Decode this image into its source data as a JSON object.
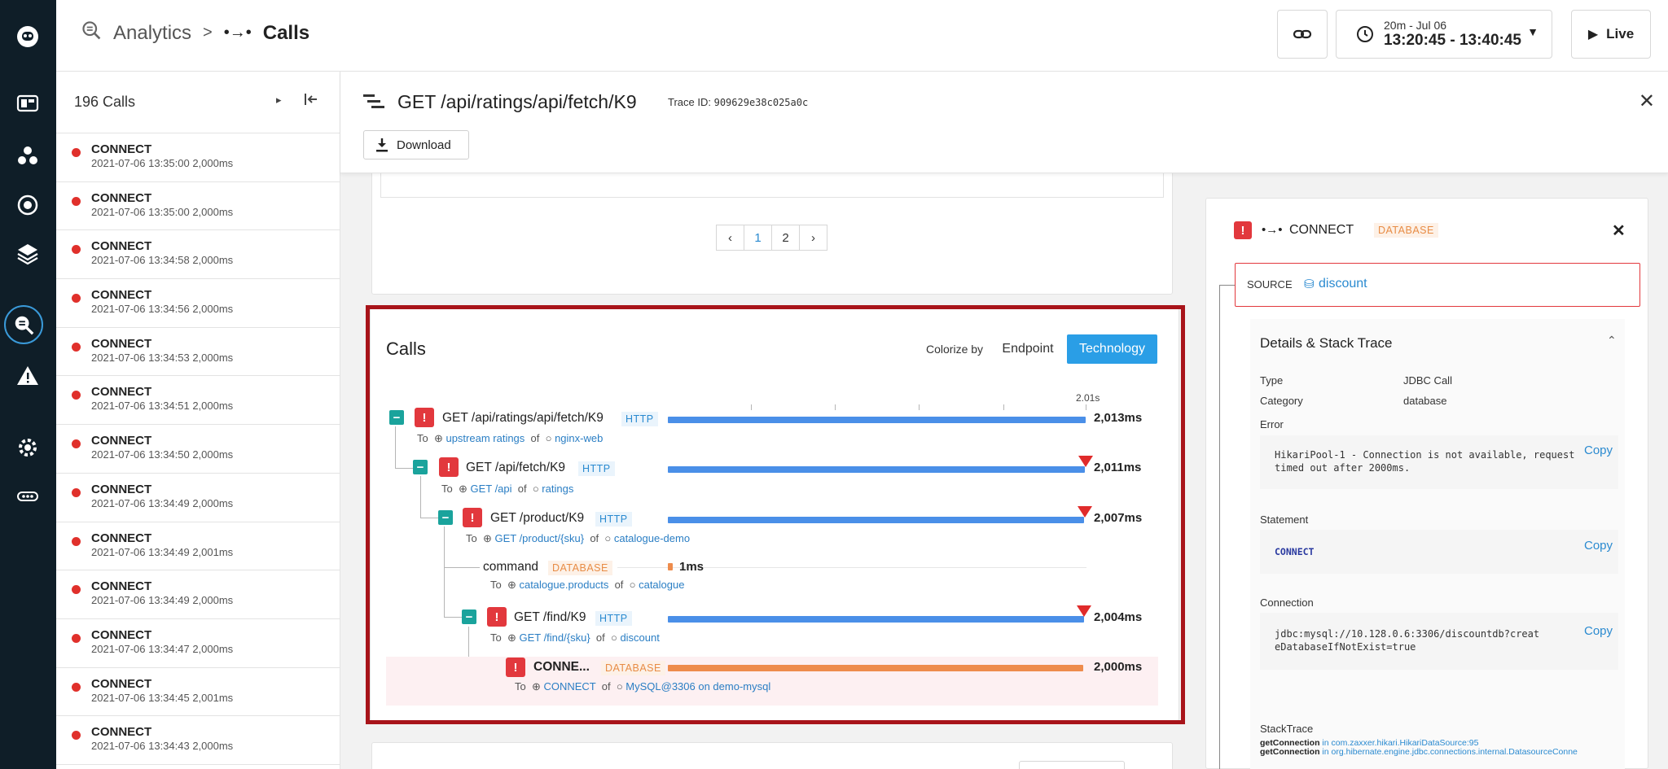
{
  "header": {
    "breadcrumb_root": "Analytics",
    "breadcrumb_sep": ">",
    "breadcrumb_current": "Calls",
    "time_range_label": "20m - Jul 06",
    "time_range_value": "13:20:45 - 13:40:45",
    "live_label": "Live"
  },
  "calls_list": {
    "count_label": "196 Calls",
    "items": [
      {
        "name": "CONNECT",
        "meta": "2021-07-06 13:35:00  2,000ms"
      },
      {
        "name": "CONNECT",
        "meta": "2021-07-06 13:35:00  2,000ms"
      },
      {
        "name": "CONNECT",
        "meta": "2021-07-06 13:34:58  2,000ms"
      },
      {
        "name": "CONNECT",
        "meta": "2021-07-06 13:34:56  2,000ms"
      },
      {
        "name": "CONNECT",
        "meta": "2021-07-06 13:34:53  2,000ms"
      },
      {
        "name": "CONNECT",
        "meta": "2021-07-06 13:34:51  2,000ms"
      },
      {
        "name": "CONNECT",
        "meta": "2021-07-06 13:34:50  2,000ms"
      },
      {
        "name": "CONNECT",
        "meta": "2021-07-06 13:34:49  2,000ms"
      },
      {
        "name": "CONNECT",
        "meta": "2021-07-06 13:34:49  2,001ms"
      },
      {
        "name": "CONNECT",
        "meta": "2021-07-06 13:34:49  2,000ms"
      },
      {
        "name": "CONNECT",
        "meta": "2021-07-06 13:34:47  2,000ms"
      },
      {
        "name": "CONNECT",
        "meta": "2021-07-06 13:34:45  2,001ms"
      },
      {
        "name": "CONNECT",
        "meta": "2021-07-06 13:34:43  2,000ms"
      }
    ]
  },
  "trace": {
    "title": "GET /api/ratings/api/fetch/K9",
    "trace_id_label": "Trace ID:",
    "trace_id": "909629e38c025a0c",
    "download_label": "Download"
  },
  "pager": {
    "prev": "‹",
    "pages": [
      "1",
      "2"
    ],
    "next": "›",
    "current": "1"
  },
  "calls_panel": {
    "title": "Calls",
    "colorize_label": "Colorize by",
    "endpoint_label": "Endpoint",
    "technology_label": "Technology",
    "axis_max_label": "2.01s",
    "to_label": "To",
    "of_label": "of",
    "calls": [
      {
        "name": "GET /api/ratings/api/fetch/K9",
        "tech": "HTTP",
        "to_endpoint": "upstream ratings",
        "to_service": "nginx-web",
        "duration": "2,013ms",
        "ms": 2013
      },
      {
        "name": "GET /api/fetch/K9",
        "tech": "HTTP",
        "to_endpoint": "GET /api",
        "to_service": "ratings",
        "duration": "2,011ms",
        "ms": 2011
      },
      {
        "name": "GET /product/K9",
        "tech": "HTTP",
        "to_endpoint": "GET /product/{sku}",
        "to_service": "catalogue-demo",
        "duration": "2,007ms",
        "ms": 2007
      },
      {
        "name": "command",
        "tech": "DATABASE",
        "to_endpoint": "catalogue.products",
        "to_service": "catalogue",
        "duration": "1ms",
        "ms": 1
      },
      {
        "name": "GET /find/K9",
        "tech": "HTTP",
        "to_endpoint": "GET /find/{sku}",
        "to_service": "discount",
        "duration": "2,004ms",
        "ms": 2004
      },
      {
        "name": "CONNE...",
        "tech": "DATABASE",
        "to_endpoint": "CONNECT",
        "to_service": "MySQL@3306 on demo-mysql",
        "duration": "2,000ms",
        "ms": 2000
      }
    ]
  },
  "detail": {
    "call_name": "CONNECT",
    "tech_badge": "DATABASE",
    "source_label": "SOURCE",
    "source_value": "discount",
    "section_title": "Details & Stack Trace",
    "type_label": "Type",
    "type_value": "JDBC Call",
    "category_label": "Category",
    "category_value": "database",
    "error_label": "Error",
    "error_value": "HikariPool-1 - Connection is not available, request timed out after 2000ms.",
    "statement_label": "Statement",
    "statement_value": "CONNECT",
    "connection_label": "Connection",
    "connection_value": "jdbc:mysql://10.128.0.6:3306/discountdb?createDatabaseIfNotExist=true",
    "copy_label": "Copy",
    "stacktrace_label": "StackTrace",
    "stack": [
      {
        "method": "getConnection",
        "loc": "in com.zaxxer.hikari.HikariDataSource:95"
      },
      {
        "method": "getConnection",
        "loc": "in org.hibernate.engine.jdbc.connections.internal.DatasourceConne"
      }
    ]
  },
  "colors": {
    "accent": "#2a9ee6",
    "error": "#e2383d",
    "http_bar": "#4a8fe8",
    "db_bar": "#ee8c4c",
    "highlight_border": "#a8141a",
    "rail": "#0f1e28"
  }
}
